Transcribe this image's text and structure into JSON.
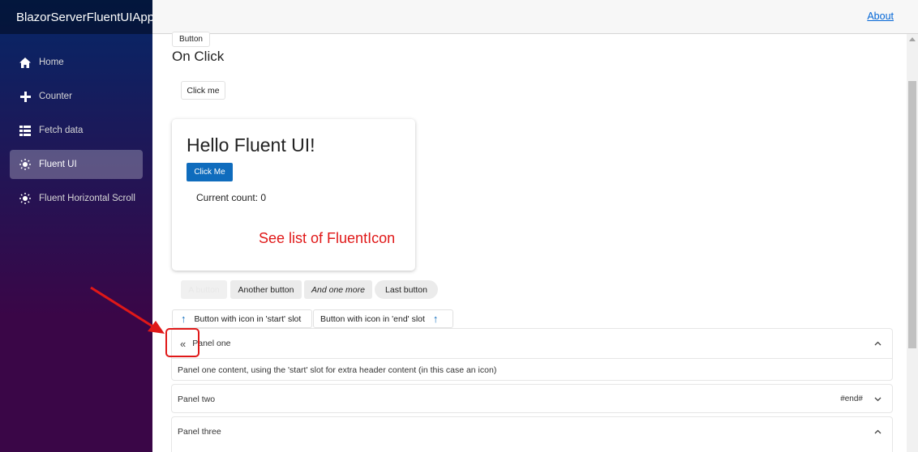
{
  "app": {
    "title": "BlazorServerFluentUIApp"
  },
  "sidebar": {
    "items": [
      {
        "label": "Home",
        "icon": "home-icon"
      },
      {
        "label": "Counter",
        "icon": "plus-icon"
      },
      {
        "label": "Fetch data",
        "icon": "list-icon"
      },
      {
        "label": "Fluent UI",
        "icon": "sun-icon",
        "active": true
      },
      {
        "label": "Fluent Horizontal Scroll",
        "icon": "sun-icon"
      }
    ]
  },
  "topbar": {
    "about_label": "About"
  },
  "main": {
    "button_label": "Button",
    "onclick_heading": "On Click",
    "click_me_label": "Click me",
    "card": {
      "title": "Hello Fluent UI!",
      "button_label": "Click Me",
      "count_text": "Current count: 0"
    },
    "annotation_text": "See list of FluentIcon",
    "buttons": {
      "disabled": "A button",
      "another": "Another button",
      "one_more": "And one more",
      "last": "Last button"
    },
    "icon_buttons": {
      "start_slot": "Button with icon in 'start' slot",
      "end_slot": "Button with icon in 'end' slot"
    },
    "accordion": {
      "panels": [
        {
          "title": "Panel one",
          "content": "Panel one content, using the 'start' slot for extra header content (in this case an icon)",
          "expanded": true
        },
        {
          "title": "Panel two",
          "end_text": "#end#",
          "expanded": false
        },
        {
          "title": "Panel three",
          "expanded": true
        }
      ]
    }
  },
  "colors": {
    "accent": "#0f6cbd",
    "annotation": "#e01818",
    "link": "#0366d6"
  }
}
